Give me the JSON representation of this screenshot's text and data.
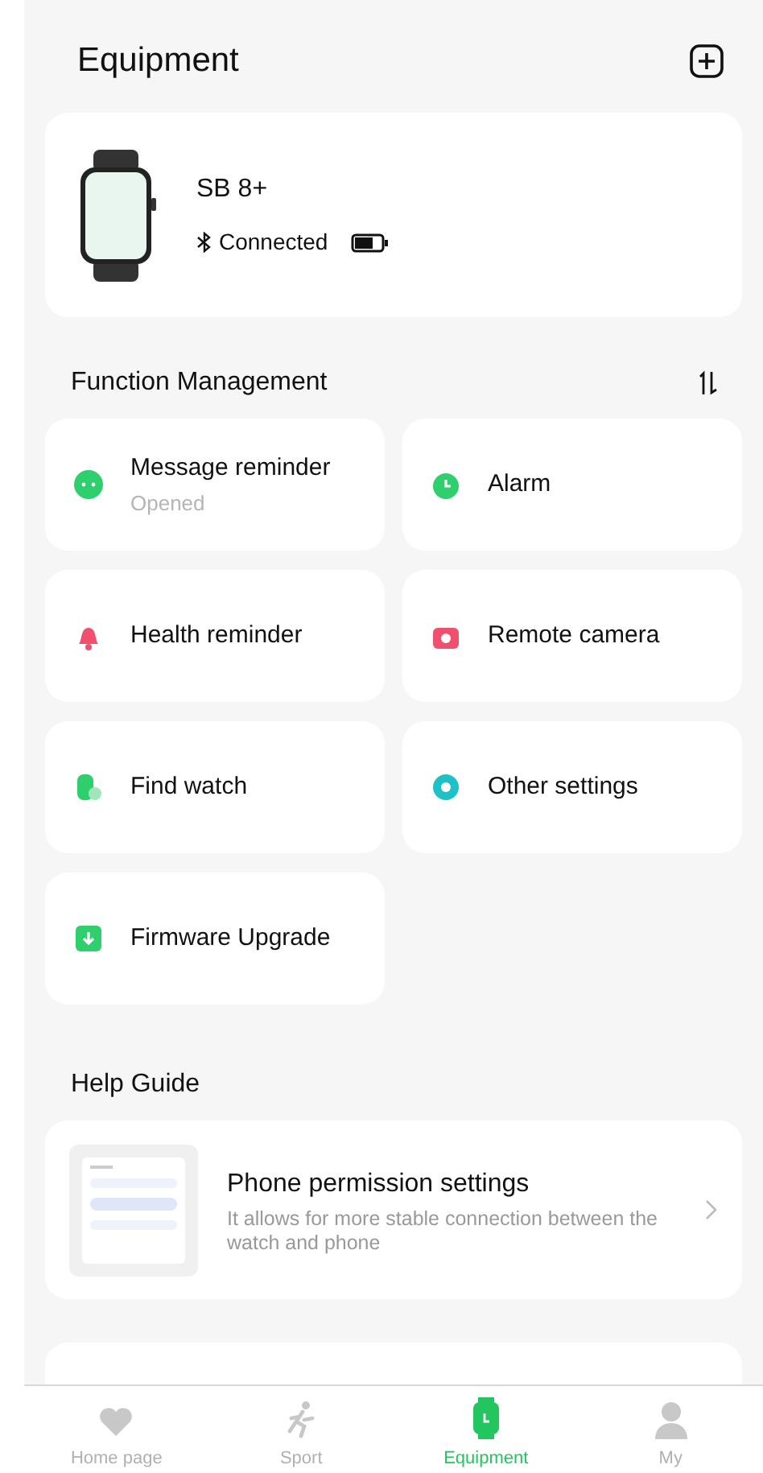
{
  "header": {
    "title": "Equipment"
  },
  "device": {
    "name": "SB 8+",
    "status": "Connected"
  },
  "function_management": {
    "title": "Function Management",
    "items": [
      {
        "label": "Message reminder",
        "subtitle": "Opened"
      },
      {
        "label": "Alarm"
      },
      {
        "label": "Health reminder"
      },
      {
        "label": "Remote camera"
      },
      {
        "label": "Find watch"
      },
      {
        "label": "Other settings"
      },
      {
        "label": "Firmware Upgrade"
      }
    ]
  },
  "help_guide": {
    "title": "Help Guide",
    "items": [
      {
        "title": "Phone permission settings",
        "description": "It allows for more stable connection between the watch and phone"
      }
    ]
  },
  "tab_bar": [
    {
      "label": "Home page",
      "selected": false
    },
    {
      "label": "Sport",
      "selected": false
    },
    {
      "label": "Equipment",
      "selected": true
    },
    {
      "label": "My",
      "selected": false
    }
  ]
}
